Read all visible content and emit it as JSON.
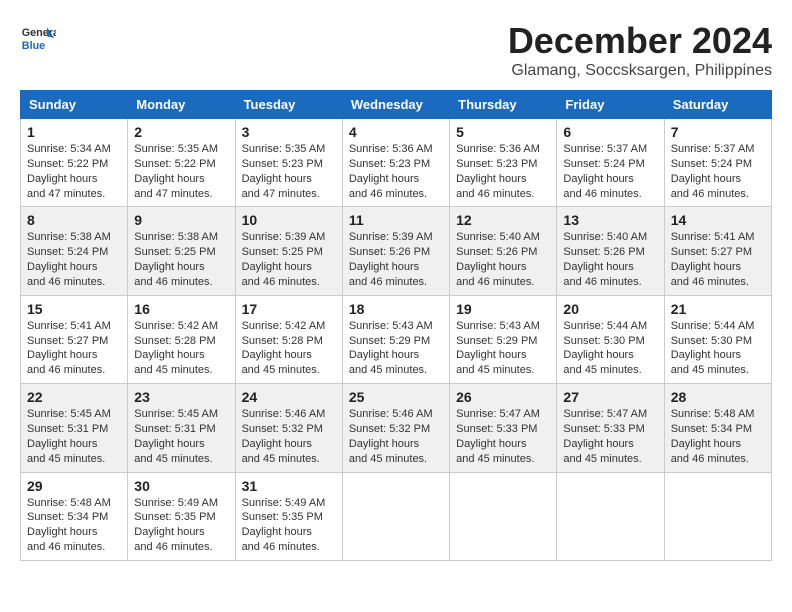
{
  "header": {
    "logo_line1": "General",
    "logo_line2": "Blue",
    "month": "December 2024",
    "location": "Glamang, Soccsksargen, Philippines"
  },
  "weekdays": [
    "Sunday",
    "Monday",
    "Tuesday",
    "Wednesday",
    "Thursday",
    "Friday",
    "Saturday"
  ],
  "weeks": [
    [
      {
        "day": 1,
        "sunrise": "5:34 AM",
        "sunset": "5:22 PM",
        "daylight": "11 hours and 47 minutes."
      },
      {
        "day": 2,
        "sunrise": "5:35 AM",
        "sunset": "5:22 PM",
        "daylight": "11 hours and 47 minutes."
      },
      {
        "day": 3,
        "sunrise": "5:35 AM",
        "sunset": "5:23 PM",
        "daylight": "11 hours and 47 minutes."
      },
      {
        "day": 4,
        "sunrise": "5:36 AM",
        "sunset": "5:23 PM",
        "daylight": "11 hours and 46 minutes."
      },
      {
        "day": 5,
        "sunrise": "5:36 AM",
        "sunset": "5:23 PM",
        "daylight": "11 hours and 46 minutes."
      },
      {
        "day": 6,
        "sunrise": "5:37 AM",
        "sunset": "5:24 PM",
        "daylight": "11 hours and 46 minutes."
      },
      {
        "day": 7,
        "sunrise": "5:37 AM",
        "sunset": "5:24 PM",
        "daylight": "11 hours and 46 minutes."
      }
    ],
    [
      {
        "day": 8,
        "sunrise": "5:38 AM",
        "sunset": "5:24 PM",
        "daylight": "11 hours and 46 minutes."
      },
      {
        "day": 9,
        "sunrise": "5:38 AM",
        "sunset": "5:25 PM",
        "daylight": "11 hours and 46 minutes."
      },
      {
        "day": 10,
        "sunrise": "5:39 AM",
        "sunset": "5:25 PM",
        "daylight": "11 hours and 46 minutes."
      },
      {
        "day": 11,
        "sunrise": "5:39 AM",
        "sunset": "5:26 PM",
        "daylight": "11 hours and 46 minutes."
      },
      {
        "day": 12,
        "sunrise": "5:40 AM",
        "sunset": "5:26 PM",
        "daylight": "11 hours and 46 minutes."
      },
      {
        "day": 13,
        "sunrise": "5:40 AM",
        "sunset": "5:26 PM",
        "daylight": "11 hours and 46 minutes."
      },
      {
        "day": 14,
        "sunrise": "5:41 AM",
        "sunset": "5:27 PM",
        "daylight": "11 hours and 46 minutes."
      }
    ],
    [
      {
        "day": 15,
        "sunrise": "5:41 AM",
        "sunset": "5:27 PM",
        "daylight": "11 hours and 46 minutes."
      },
      {
        "day": 16,
        "sunrise": "5:42 AM",
        "sunset": "5:28 PM",
        "daylight": "11 hours and 45 minutes."
      },
      {
        "day": 17,
        "sunrise": "5:42 AM",
        "sunset": "5:28 PM",
        "daylight": "11 hours and 45 minutes."
      },
      {
        "day": 18,
        "sunrise": "5:43 AM",
        "sunset": "5:29 PM",
        "daylight": "11 hours and 45 minutes."
      },
      {
        "day": 19,
        "sunrise": "5:43 AM",
        "sunset": "5:29 PM",
        "daylight": "11 hours and 45 minutes."
      },
      {
        "day": 20,
        "sunrise": "5:44 AM",
        "sunset": "5:30 PM",
        "daylight": "11 hours and 45 minutes."
      },
      {
        "day": 21,
        "sunrise": "5:44 AM",
        "sunset": "5:30 PM",
        "daylight": "11 hours and 45 minutes."
      }
    ],
    [
      {
        "day": 22,
        "sunrise": "5:45 AM",
        "sunset": "5:31 PM",
        "daylight": "11 hours and 45 minutes."
      },
      {
        "day": 23,
        "sunrise": "5:45 AM",
        "sunset": "5:31 PM",
        "daylight": "11 hours and 45 minutes."
      },
      {
        "day": 24,
        "sunrise": "5:46 AM",
        "sunset": "5:32 PM",
        "daylight": "11 hours and 45 minutes."
      },
      {
        "day": 25,
        "sunrise": "5:46 AM",
        "sunset": "5:32 PM",
        "daylight": "11 hours and 45 minutes."
      },
      {
        "day": 26,
        "sunrise": "5:47 AM",
        "sunset": "5:33 PM",
        "daylight": "11 hours and 45 minutes."
      },
      {
        "day": 27,
        "sunrise": "5:47 AM",
        "sunset": "5:33 PM",
        "daylight": "11 hours and 45 minutes."
      },
      {
        "day": 28,
        "sunrise": "5:48 AM",
        "sunset": "5:34 PM",
        "daylight": "11 hours and 46 minutes."
      }
    ],
    [
      {
        "day": 29,
        "sunrise": "5:48 AM",
        "sunset": "5:34 PM",
        "daylight": "11 hours and 46 minutes."
      },
      {
        "day": 30,
        "sunrise": "5:49 AM",
        "sunset": "5:35 PM",
        "daylight": "11 hours and 46 minutes."
      },
      {
        "day": 31,
        "sunrise": "5:49 AM",
        "sunset": "5:35 PM",
        "daylight": "11 hours and 46 minutes."
      },
      null,
      null,
      null,
      null
    ]
  ]
}
